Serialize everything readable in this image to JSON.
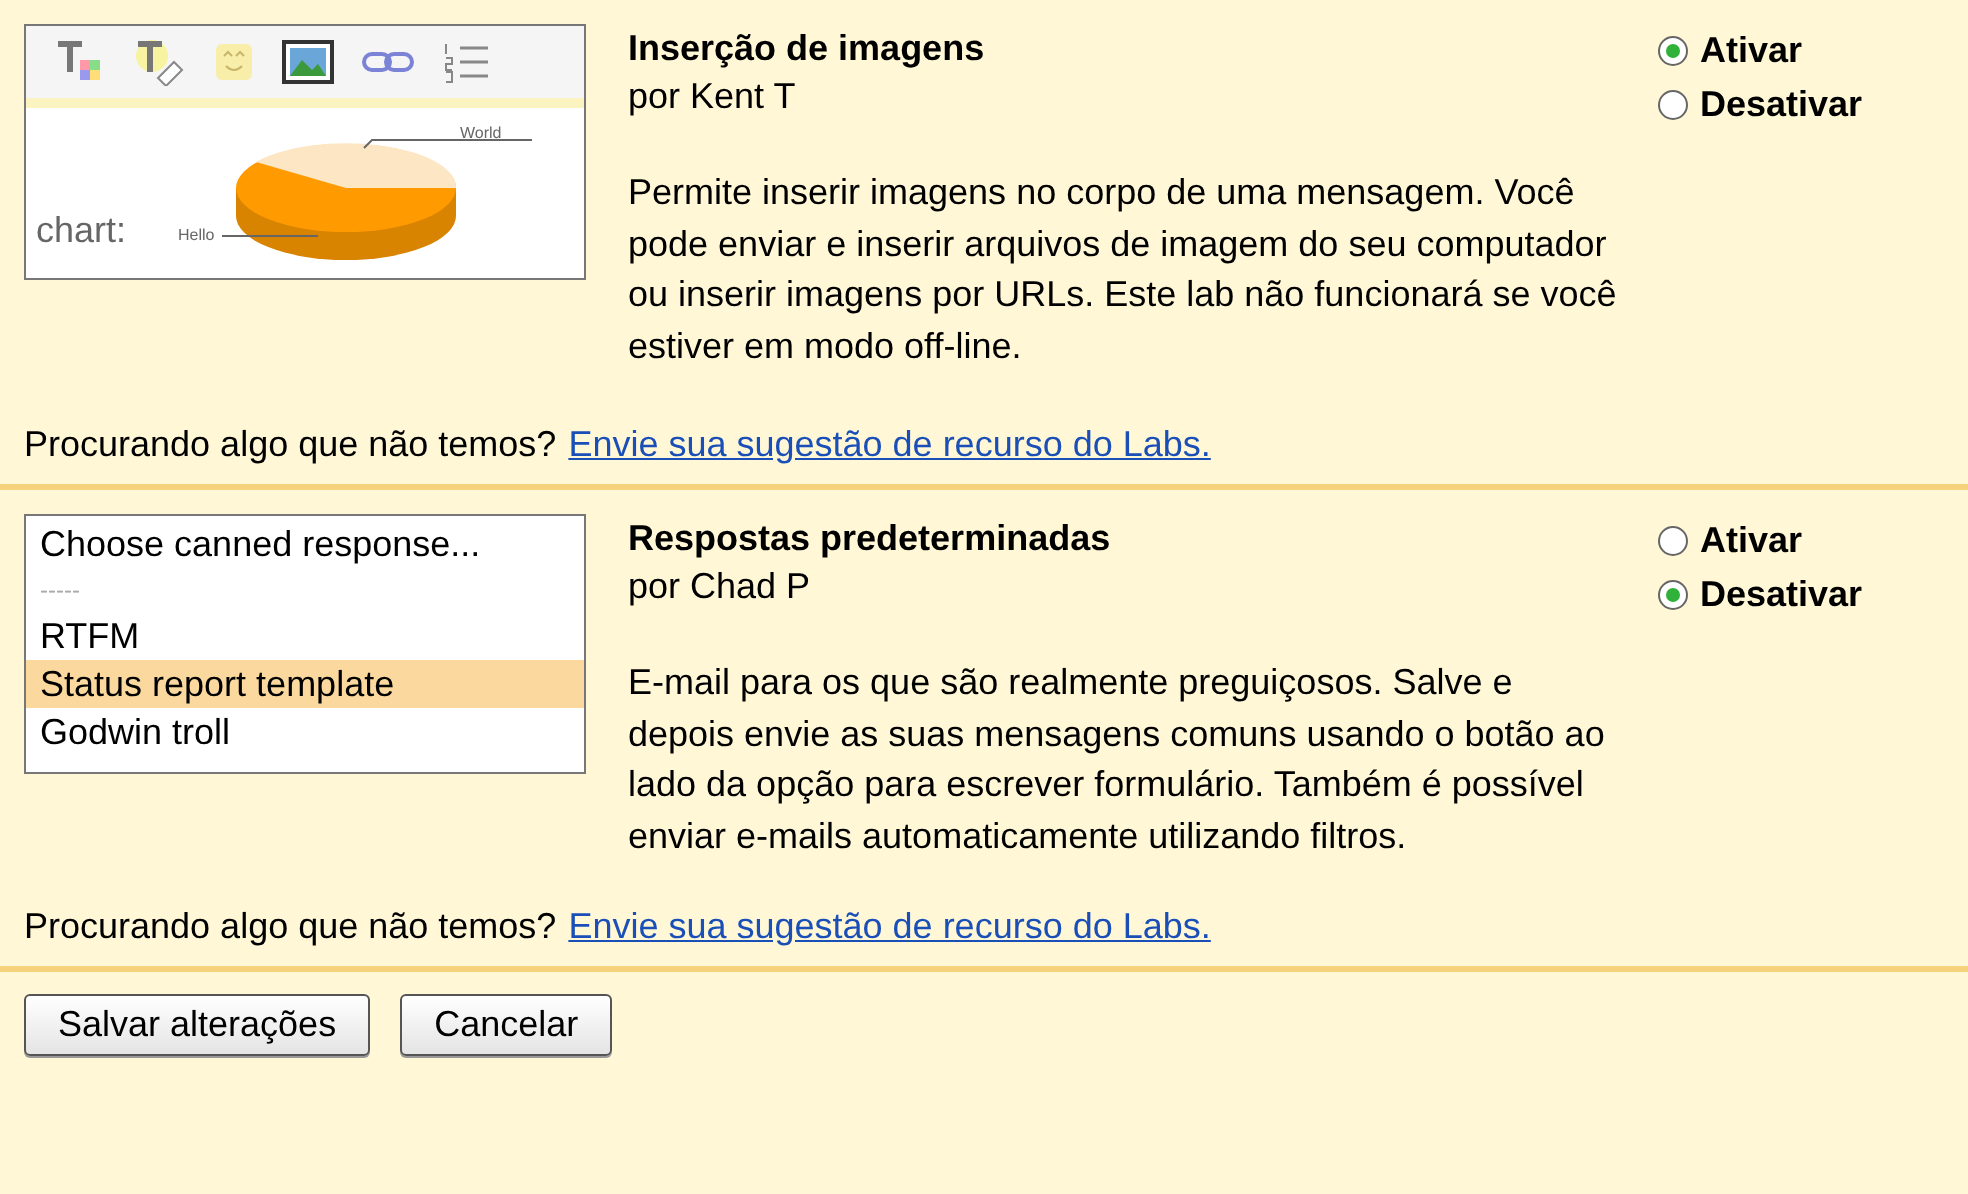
{
  "labs": [
    {
      "title": "Inserção de imagens",
      "author": "por Kent T",
      "description": "Permite inserir imagens no corpo de uma mensagem. Você pode enviar e inserir arquivos de imagem do seu computador ou inserir imagens por URLs. Este lab não funcionará se você estiver em modo off-line.",
      "options": [
        {
          "label": "Ativar",
          "selected": true
        },
        {
          "label": "Desativar",
          "selected": false
        }
      ],
      "preview": {
        "kind": "editor",
        "chart_caption": "chart:",
        "slice_labels": [
          "World",
          "Hello"
        ]
      },
      "footer": {
        "text": "Procurando algo que não temos?",
        "link": "Envie sua sugestão de recurso do Labs."
      }
    },
    {
      "title": "Respostas predeterminadas",
      "author": "por Chad P",
      "description": "E-mail para os que são realmente preguiçosos. Salve e depois envie as suas mensagens comuns usando o botão ao lado da opção para escrever formulário. Também é possível enviar e-mails automaticamente utilizando filtros.",
      "options": [
        {
          "label": "Ativar",
          "selected": false
        },
        {
          "label": "Desativar",
          "selected": true
        }
      ],
      "preview": {
        "kind": "list",
        "items": [
          {
            "label": "Choose canned response...",
            "kind": "option",
            "selected": false
          },
          {
            "label": "-----",
            "kind": "separator",
            "selected": false
          },
          {
            "label": "RTFM",
            "kind": "option",
            "selected": false
          },
          {
            "label": "Status report template",
            "kind": "option",
            "selected": true
          },
          {
            "label": "Godwin troll",
            "kind": "option",
            "selected": false
          }
        ]
      },
      "footer": {
        "text": "Procurando algo que não temos?",
        "link": "Envie sua sugestão de recurso do Labs."
      }
    }
  ],
  "buttons": [
    "Salvar alterações",
    "Cancelar"
  ]
}
